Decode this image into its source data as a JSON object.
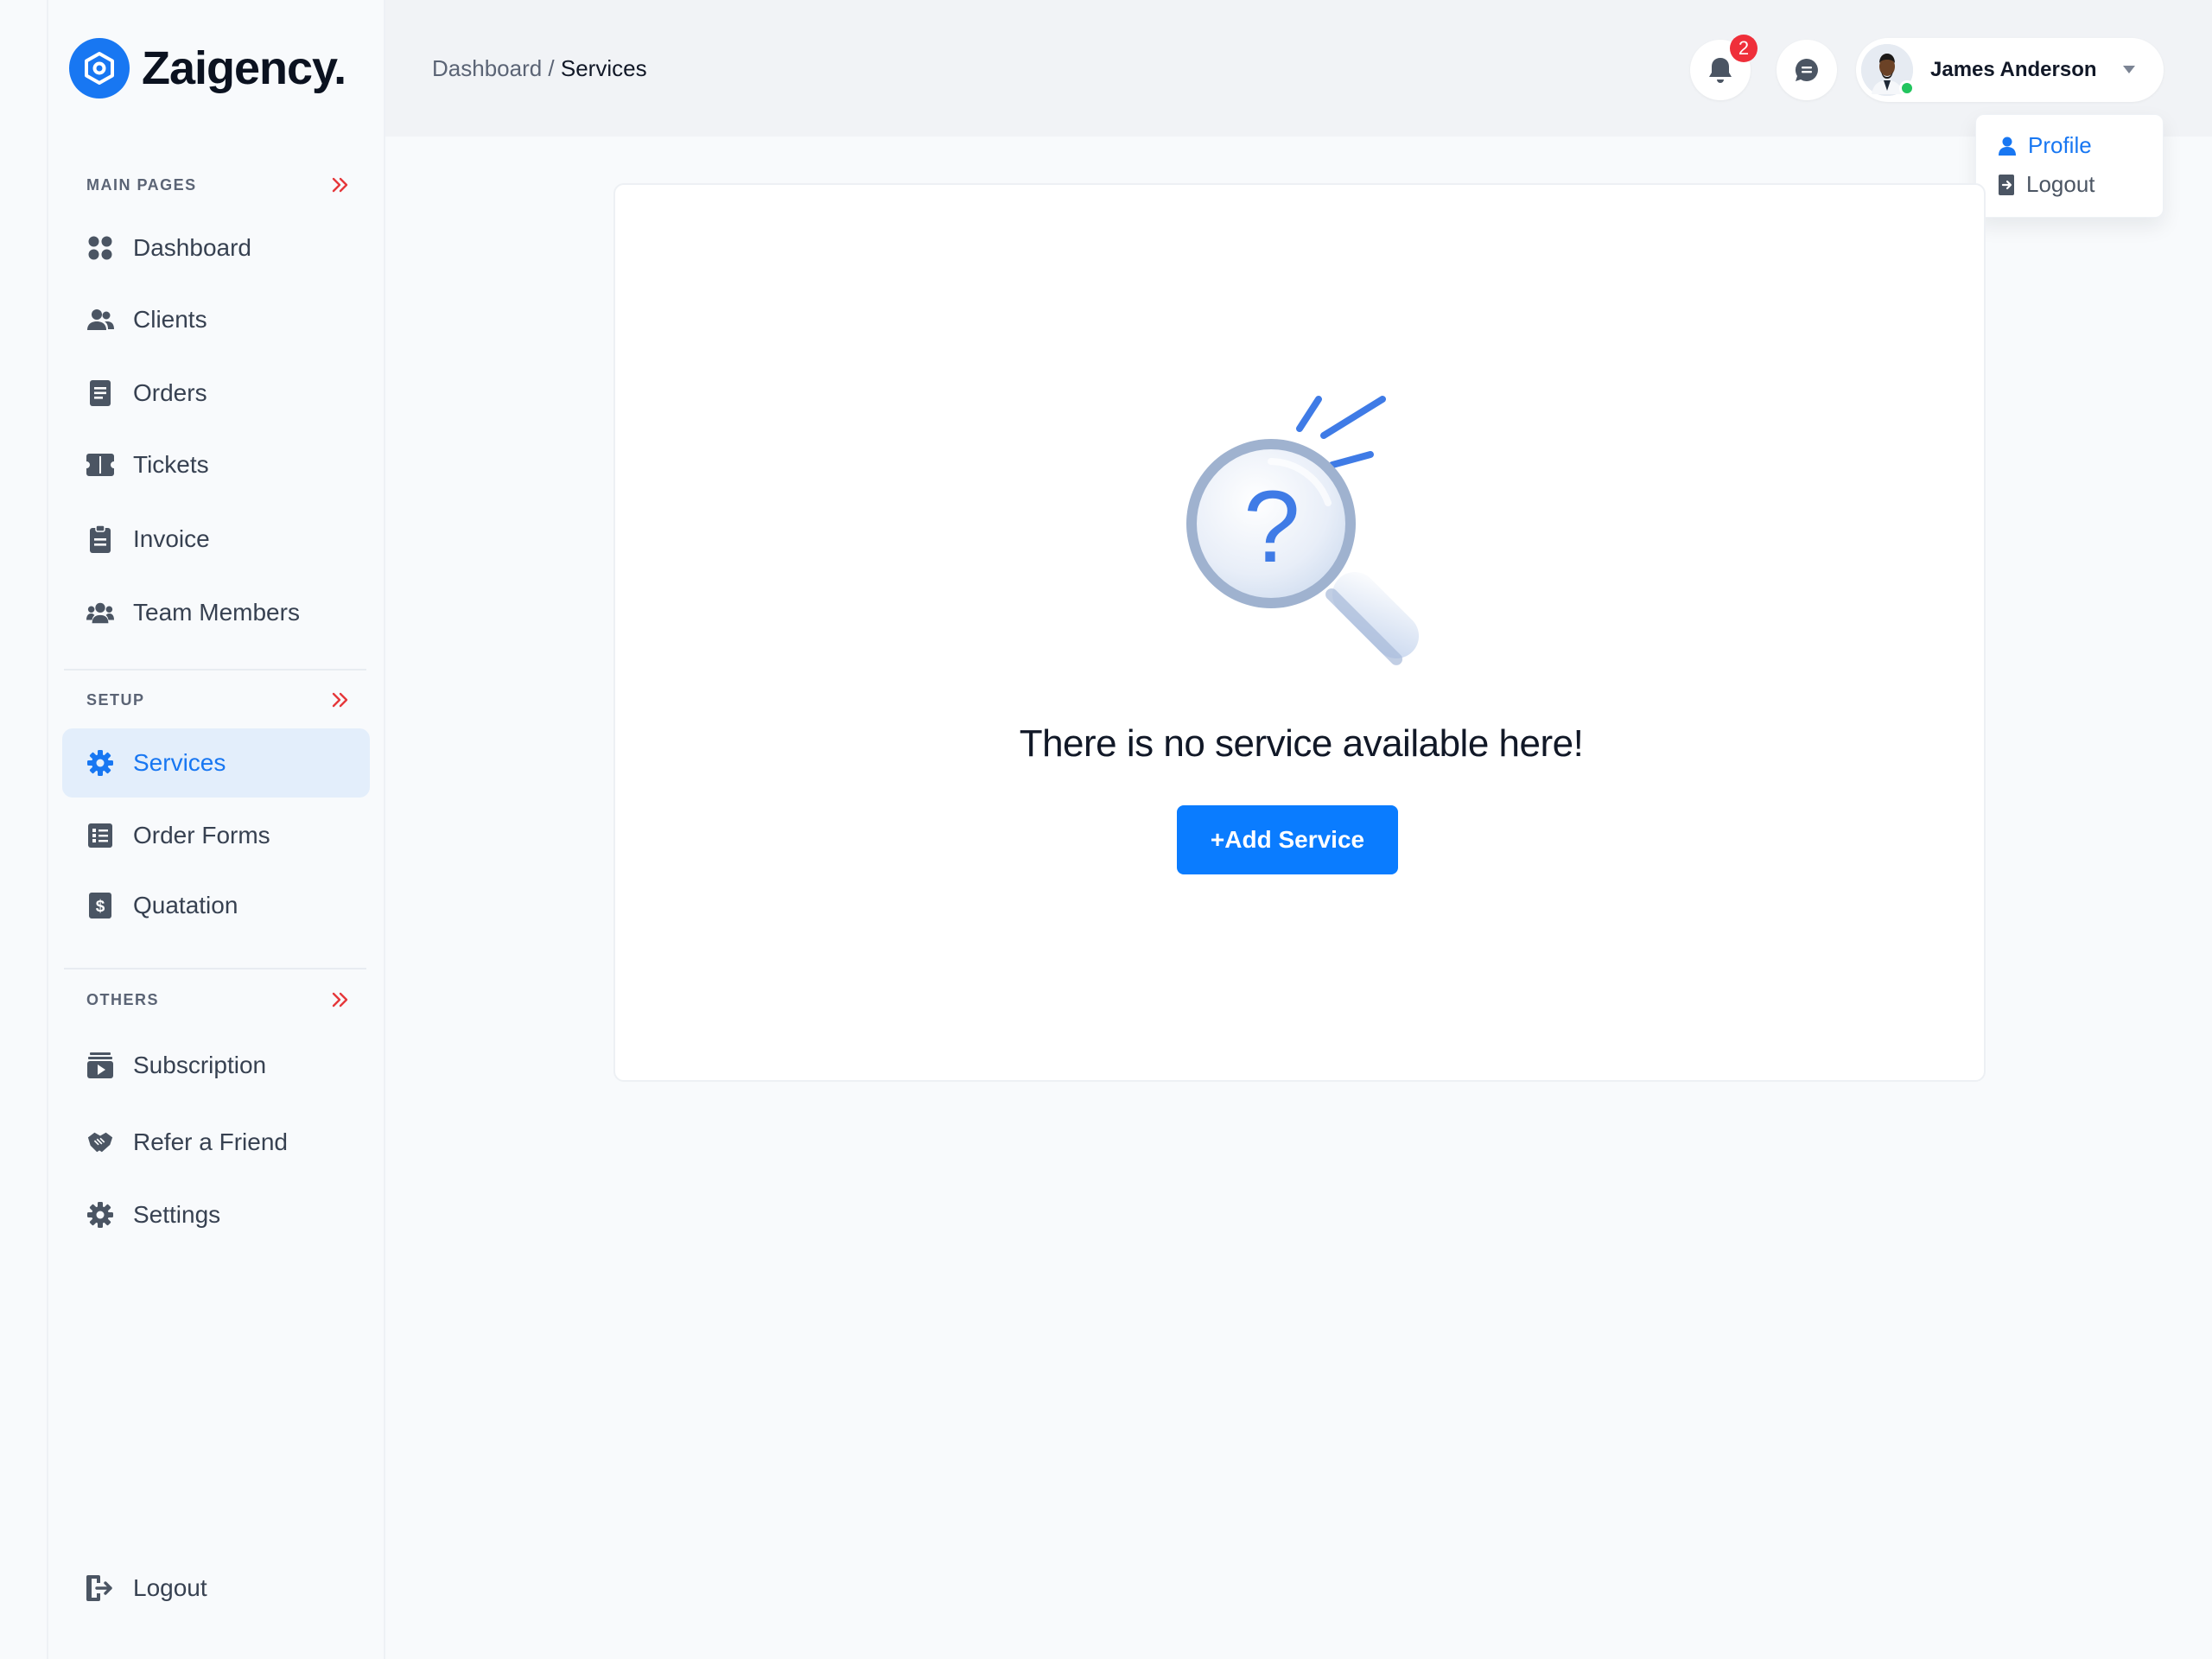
{
  "brand": {
    "name": "Zaigency."
  },
  "sidebar": {
    "sections": [
      {
        "title": "MAIN PAGES",
        "items": [
          "Dashboard",
          "Clients",
          "Orders",
          "Tickets",
          "Invoice",
          "Team Members"
        ]
      },
      {
        "title": "SETUP",
        "items": [
          "Services",
          "Order Forms",
          "Quatation"
        ]
      },
      {
        "title": "OTHERS",
        "items": [
          "Subscription",
          "Refer a Friend",
          "Settings"
        ]
      }
    ],
    "active_item": "Services",
    "logout_label": "Logout"
  },
  "header": {
    "breadcrumb": {
      "parent": "Dashboard",
      "separator": " / ",
      "current": "Services"
    },
    "notifications_count": "2",
    "user": {
      "name": "James Anderson"
    }
  },
  "user_menu": {
    "items": [
      "Profile",
      "Logout"
    ]
  },
  "main": {
    "empty_message": "There is no service available here!",
    "add_button_label": "+Add Service"
  },
  "colors": {
    "accent": "#1877f2",
    "button": "#0a7cff",
    "badge": "#ef2f3a",
    "section_arrow": "#e5383b",
    "online": "#22c55e"
  }
}
